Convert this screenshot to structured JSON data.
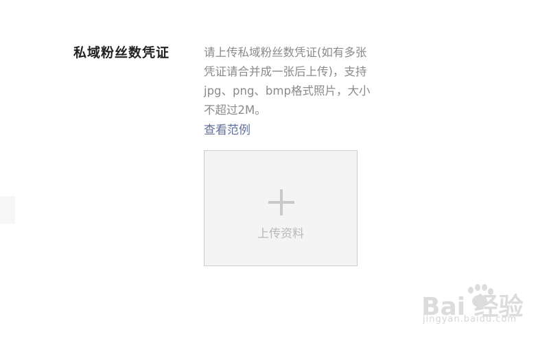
{
  "form": {
    "field_label": "私域粉丝数凭证",
    "hint_lines": [
      "请上传私域粉丝数凭证(如有多张",
      "凭证请合并成一张后上传)，支持",
      "jpg、png、bmp格式照片，大小",
      "不超过2M。"
    ],
    "example_link": "查看范例",
    "upload": {
      "icon": "plus-icon",
      "label": "上传资料"
    }
  },
  "watermark": {
    "logo_text": "Bai 经验",
    "sub_text": "jingyan.baidu.com"
  },
  "colors": {
    "link": "#5d6f9a",
    "hint_text": "#8a8a8a",
    "upload_bg": "#f4f4f4",
    "upload_border": "#cdcdcd"
  }
}
